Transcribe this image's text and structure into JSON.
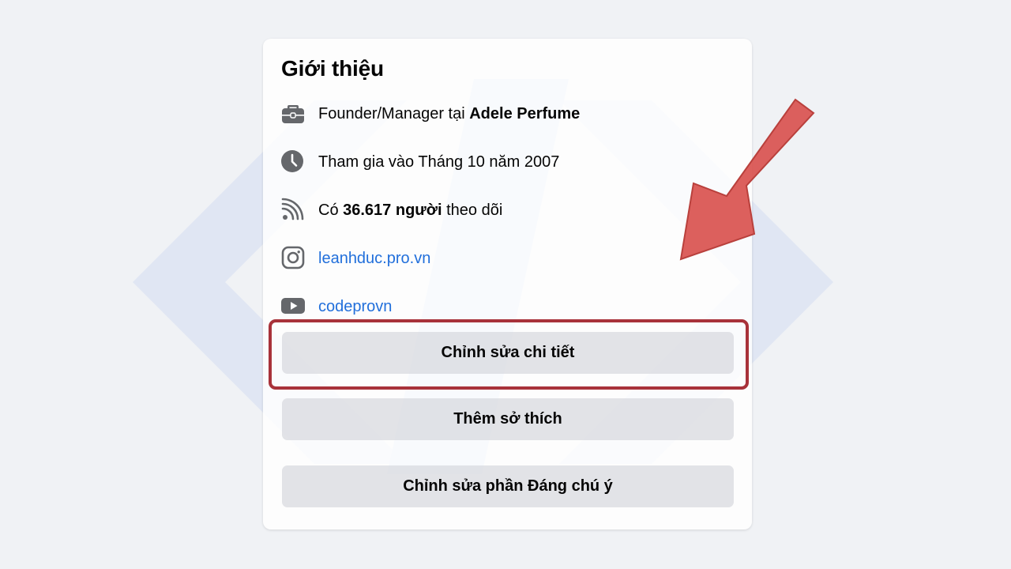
{
  "about": {
    "title": "Giới thiệu",
    "work": {
      "prefix": "Founder/Manager tại ",
      "company": "Adele Perfume",
      "icon": "briefcase-icon"
    },
    "joined": {
      "text": "Tham gia vào Tháng 10 năm 2007",
      "icon": "clock-icon"
    },
    "followers": {
      "prefix": "Có ",
      "count": "36.617 người",
      "suffix": " theo dõi",
      "icon": "rss-icon"
    },
    "instagram": {
      "text": "leanhduc.pro.vn",
      "icon": "instagram-icon"
    },
    "youtube": {
      "text": "codeprovn",
      "icon": "youtube-icon"
    }
  },
  "buttons": {
    "edit_details": "Chỉnh sửa chi tiết",
    "add_hobbies": "Thêm sở thích",
    "edit_featured": "Chỉnh sửa phần Đáng chú ý"
  },
  "colors": {
    "link": "#216fdb",
    "icon": "#65676b",
    "highlight_border": "#a8323a",
    "arrow": "#d9534f"
  }
}
